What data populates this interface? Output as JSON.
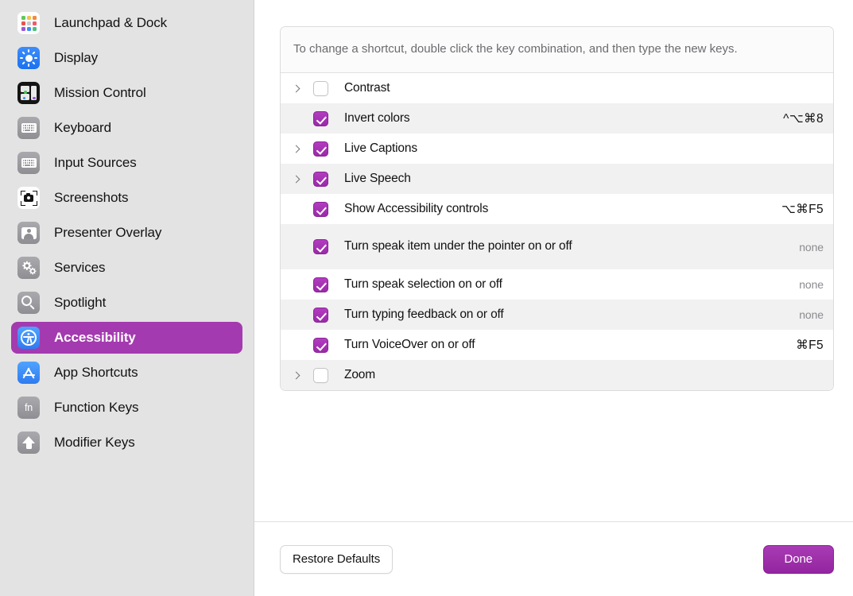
{
  "sidebar": {
    "items": [
      {
        "label": "Launchpad & Dock",
        "icon": "launchpad-icon",
        "selected": false
      },
      {
        "label": "Display",
        "icon": "display-icon",
        "selected": false
      },
      {
        "label": "Mission Control",
        "icon": "mission-control-icon",
        "selected": false
      },
      {
        "label": "Keyboard",
        "icon": "keyboard-icon",
        "selected": false
      },
      {
        "label": "Input Sources",
        "icon": "input-sources-icon",
        "selected": false
      },
      {
        "label": "Screenshots",
        "icon": "screenshots-icon",
        "selected": false
      },
      {
        "label": "Presenter Overlay",
        "icon": "presenter-overlay-icon",
        "selected": false
      },
      {
        "label": "Services",
        "icon": "services-gears-icon",
        "selected": false
      },
      {
        "label": "Spotlight",
        "icon": "spotlight-magnifier-icon",
        "selected": false
      },
      {
        "label": "Accessibility",
        "icon": "accessibility-icon",
        "selected": true
      },
      {
        "label": "App Shortcuts",
        "icon": "app-store-icon",
        "selected": false
      },
      {
        "label": "Function Keys",
        "icon": "fn-key-icon",
        "selected": false
      },
      {
        "label": "Modifier Keys",
        "icon": "shift-up-arrow-icon",
        "selected": false
      }
    ]
  },
  "main": {
    "hint": "To change a shortcut, double click the key combination, and then type the new keys.",
    "shortcuts": [
      {
        "label": "Contrast",
        "checked": false,
        "expandable": true,
        "shortcut": ""
      },
      {
        "label": "Invert colors",
        "checked": true,
        "expandable": false,
        "shortcut": "^⌥⌘8"
      },
      {
        "label": "Live Captions",
        "checked": true,
        "expandable": true,
        "shortcut": ""
      },
      {
        "label": "Live Speech",
        "checked": true,
        "expandable": true,
        "shortcut": ""
      },
      {
        "label": "Show Accessibility controls",
        "checked": true,
        "expandable": false,
        "shortcut": "⌥⌘F5"
      },
      {
        "label": "Turn speak item under the pointer on or off",
        "checked": true,
        "expandable": false,
        "shortcut": "none",
        "shortcut_empty": true
      },
      {
        "label": "Turn speak selection on or off",
        "checked": true,
        "expandable": false,
        "shortcut": "none",
        "shortcut_empty": true
      },
      {
        "label": "Turn typing feedback on or off",
        "checked": true,
        "expandable": false,
        "shortcut": "none",
        "shortcut_empty": true
      },
      {
        "label": "Turn VoiceOver on or off",
        "checked": true,
        "expandable": false,
        "shortcut": "⌘F5"
      },
      {
        "label": "Zoom",
        "checked": false,
        "expandable": true,
        "shortcut": ""
      }
    ]
  },
  "footer": {
    "restore_defaults_label": "Restore Defaults",
    "done_label": "Done"
  },
  "colors": {
    "accent_purple": "#a43aaf",
    "checkbox_purple": "#9a2aa8",
    "sidebar_bg": "#e3e3e3",
    "row_alt_bg": "#f1f1f1"
  }
}
